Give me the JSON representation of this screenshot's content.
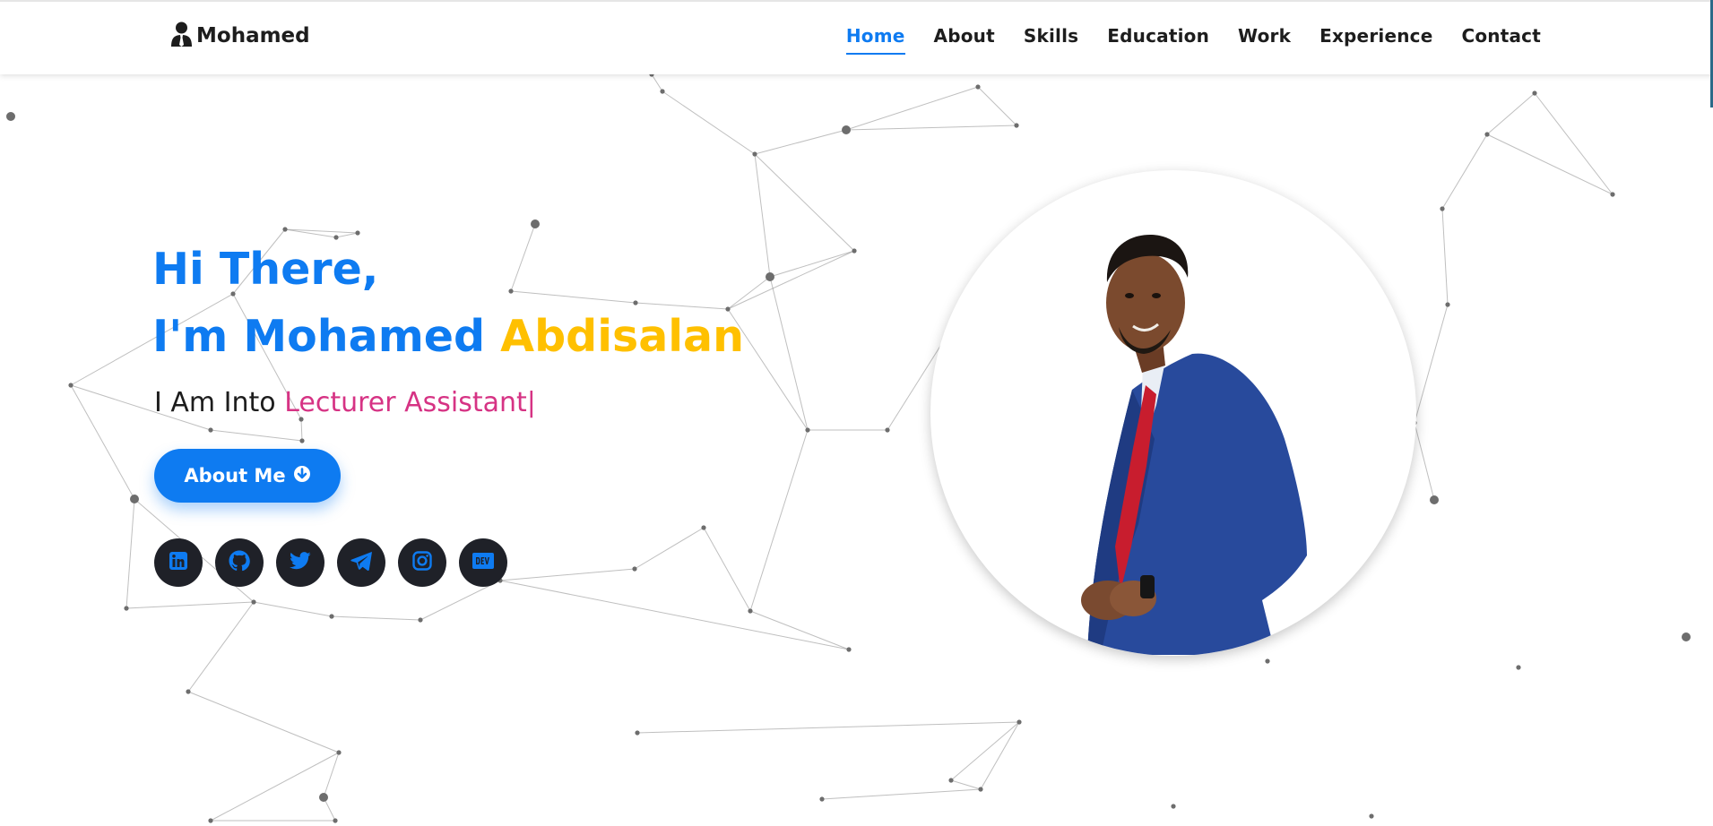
{
  "header": {
    "logo_text": "Mohamed",
    "nav": [
      {
        "label": "Home",
        "active": true
      },
      {
        "label": "About"
      },
      {
        "label": "Skills"
      },
      {
        "label": "Education"
      },
      {
        "label": "Work"
      },
      {
        "label": "Experience"
      },
      {
        "label": "Contact"
      }
    ]
  },
  "hero": {
    "line1": "Hi There,",
    "line2_a": "I'm Mohamed ",
    "line2_b": "Abdisalan",
    "sub_prefix": "I Am Into ",
    "typed": "Lecturer Assistant",
    "caret": "|",
    "button_label": "About Me"
  },
  "socials": [
    "linkedin-icon",
    "github-icon",
    "twitter-icon",
    "telegram-icon",
    "instagram-icon",
    "dev-icon"
  ],
  "colors": {
    "primary": "#0e7bf1",
    "accent": "#ffc000",
    "typed": "#d63384",
    "dark": "#1f2128"
  }
}
